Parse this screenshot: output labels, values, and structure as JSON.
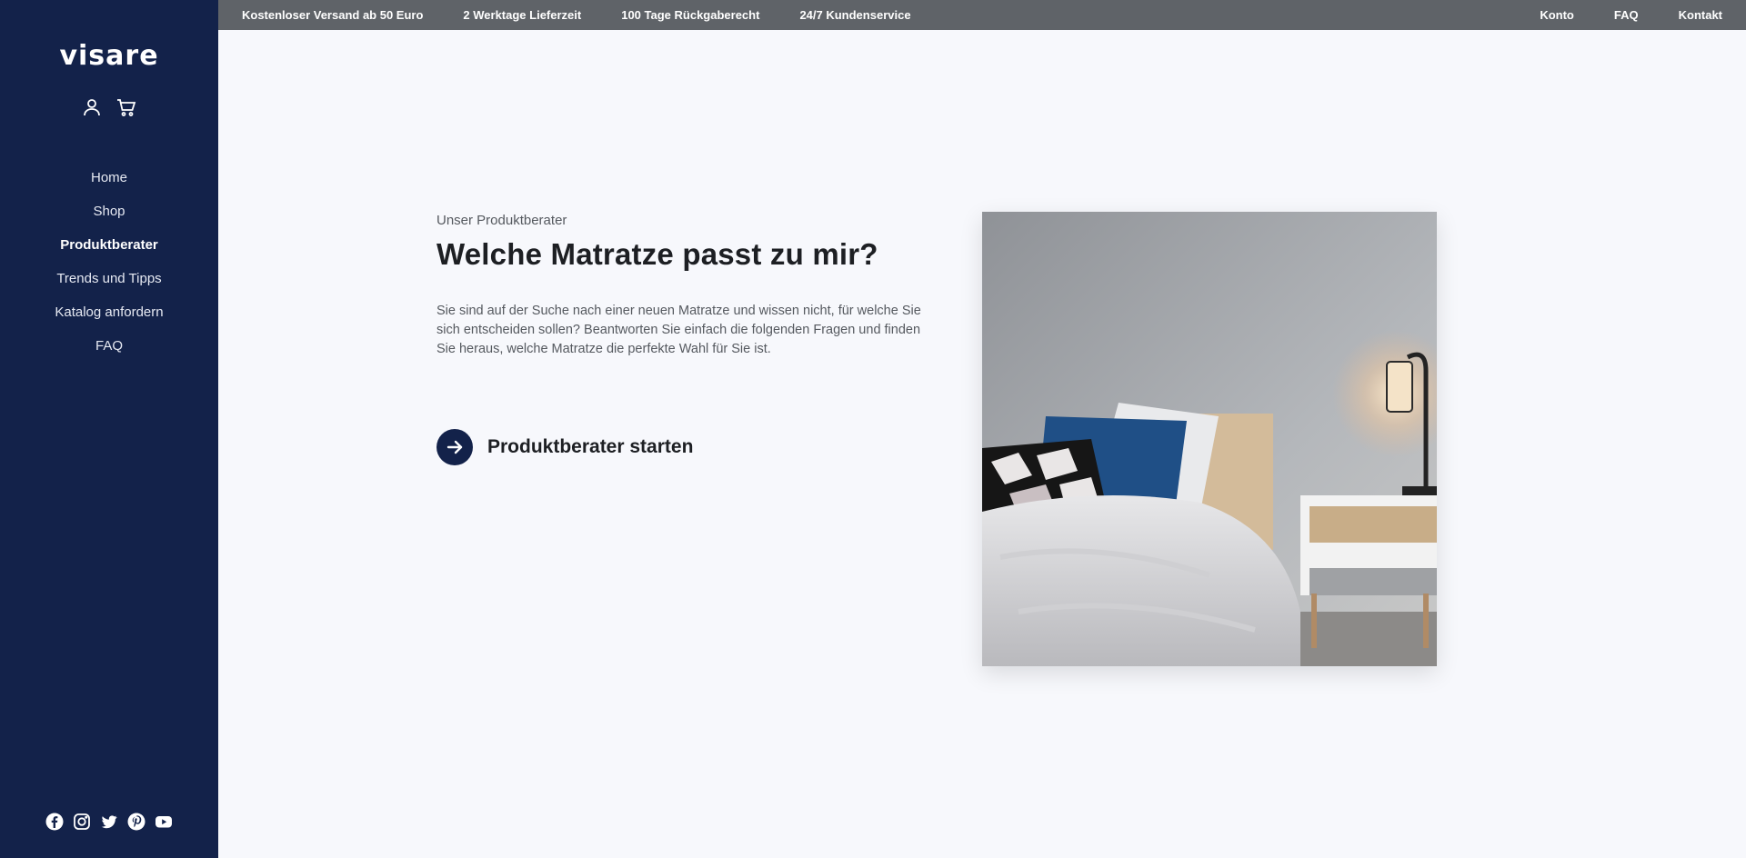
{
  "brand": {
    "logo_text": "visare"
  },
  "sidebar": {
    "icons": [
      "user-icon",
      "cart-icon"
    ],
    "nav": [
      {
        "label": "Home"
      },
      {
        "label": "Shop"
      },
      {
        "label": "Produktberater",
        "active": true
      },
      {
        "label": "Trends und Tipps"
      },
      {
        "label": "Katalog anfordern"
      },
      {
        "label": "FAQ"
      }
    ],
    "social": [
      "facebook-icon",
      "instagram-icon",
      "twitter-icon",
      "pinterest-icon",
      "youtube-icon"
    ]
  },
  "topbar": {
    "usps": [
      "Kostenloser Versand ab 50 Euro",
      "2 Werktage Lieferzeit",
      "100 Tage Rückgaberecht",
      "24/7 Kundenservice"
    ],
    "links": [
      "Konto",
      "FAQ",
      "Kontakt"
    ]
  },
  "hero": {
    "eyebrow": "Unser Produktberater",
    "headline": "Welche Matratze passt zu mir?",
    "description": "Sie sind auf der Suche nach einer neuen Matratze und wissen nicht, für welche Sie sich entscheiden sollen? Beantworten Sie einfach die folgenden Fragen und finden Sie heraus, welche Matratze die perfekte Wahl für Sie ist.",
    "cta_label": "Produktberater starten"
  },
  "colors": {
    "sidebar_bg": "#13224a",
    "topbar_bg": "#5f6368",
    "page_bg": "#f7f8fc",
    "accent": "#13224a"
  }
}
